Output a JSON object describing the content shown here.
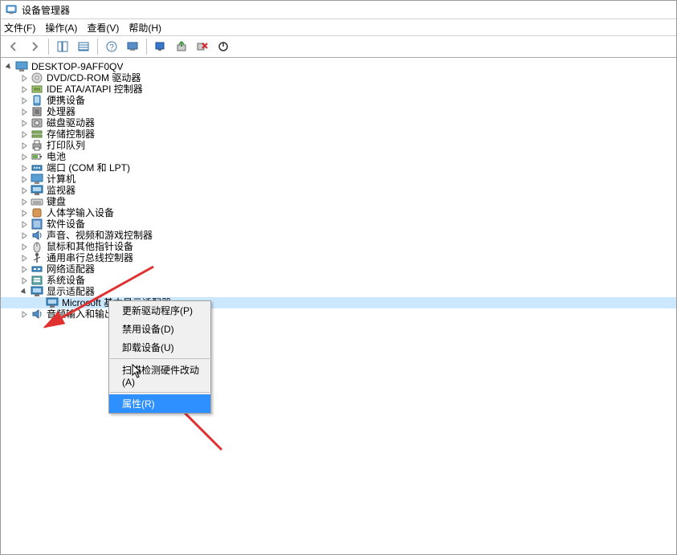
{
  "window": {
    "title": "设备管理器"
  },
  "menu": {
    "file": "文件(F)",
    "action": "操作(A)",
    "view": "查看(V)",
    "help": "帮助(H)"
  },
  "root": {
    "name": "DESKTOP-9AFF0QV"
  },
  "categories": [
    {
      "label": "DVD/CD-ROM 驱动器",
      "icon": "disc"
    },
    {
      "label": "IDE ATA/ATAPI 控制器",
      "icon": "ide"
    },
    {
      "label": "便携设备",
      "icon": "portable"
    },
    {
      "label": "处理器",
      "icon": "cpu"
    },
    {
      "label": "磁盘驱动器",
      "icon": "disk"
    },
    {
      "label": "存储控制器",
      "icon": "storage"
    },
    {
      "label": "打印队列",
      "icon": "printer"
    },
    {
      "label": "电池",
      "icon": "battery"
    },
    {
      "label": "端口 (COM 和 LPT)",
      "icon": "port"
    },
    {
      "label": "计算机",
      "icon": "computer"
    },
    {
      "label": "监视器",
      "icon": "monitor"
    },
    {
      "label": "键盘",
      "icon": "keyboard"
    },
    {
      "label": "人体学输入设备",
      "icon": "hid"
    },
    {
      "label": "软件设备",
      "icon": "software"
    },
    {
      "label": "声音、视频和游戏控制器",
      "icon": "audio"
    },
    {
      "label": "鼠标和其他指针设备",
      "icon": "mouse"
    },
    {
      "label": "通用串行总线控制器",
      "icon": "usb"
    },
    {
      "label": "网络适配器",
      "icon": "network"
    },
    {
      "label": "系统设备",
      "icon": "system"
    }
  ],
  "expanded_category": {
    "label": "显示适配器",
    "icon": "display"
  },
  "expanded_child": {
    "label": "Microsoft 基本显示适配器",
    "icon": "display"
  },
  "last_category": {
    "label": "音频输入和输出",
    "icon": "audioio"
  },
  "context_menu": {
    "items": [
      {
        "label": "更新驱动程序(P)"
      },
      {
        "label": "禁用设备(D)"
      },
      {
        "label": "卸载设备(U)"
      }
    ],
    "items2": [
      {
        "label": "扫描检测硬件改动(A)"
      }
    ],
    "items3": [
      {
        "label": "属性(R)",
        "hovered": true
      }
    ]
  }
}
